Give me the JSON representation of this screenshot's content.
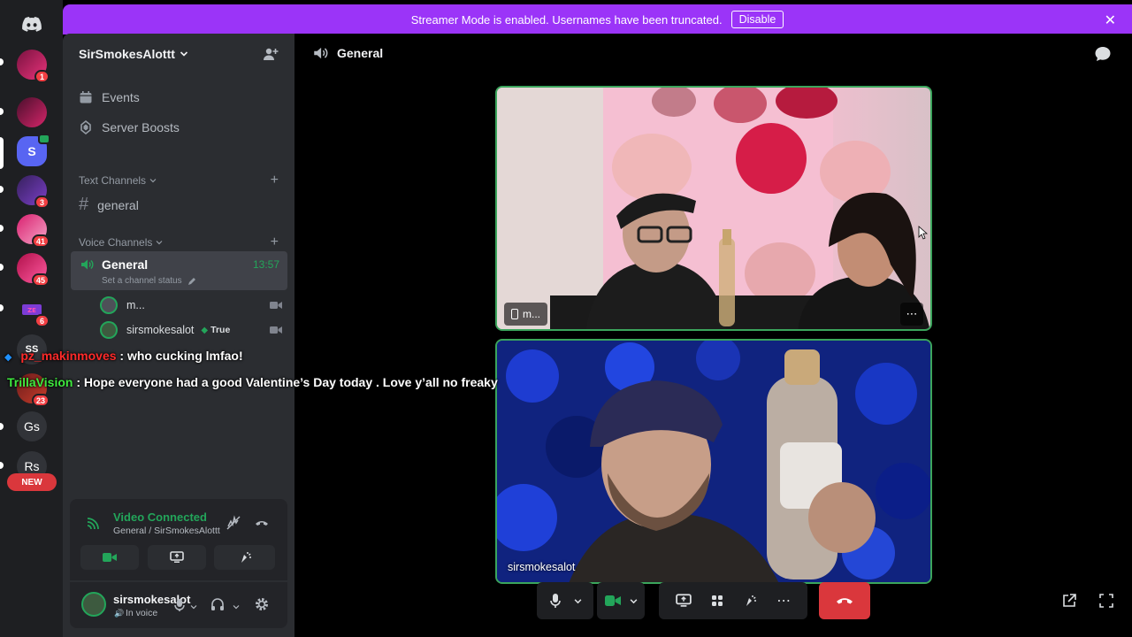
{
  "banner": {
    "message": "Streamer Mode is enabled. Usernames have been truncated.",
    "disable_label": "Disable"
  },
  "rail": {
    "badges": [
      "1",
      "3",
      "41",
      "45",
      "6",
      "23"
    ],
    "text_servers": [
      "SS",
      "Gs",
      "Rs"
    ],
    "selected_letter": "S",
    "new_label": "NEW"
  },
  "server": {
    "name": "SirSmokesAlottt",
    "events": "Events",
    "boosts": "Server Boosts",
    "text_channels_label": "Text Channels",
    "text_channel": "general",
    "voice_channels_label": "Voice Channels",
    "voice_channel": "General",
    "voice_time": "13:57",
    "channel_status_placeholder": "Set a channel status",
    "members": [
      {
        "name": "m..."
      },
      {
        "name": "sirsmokesalot",
        "badge": "True"
      }
    ]
  },
  "chat_overlay": [
    {
      "user": "pz_makinmoves",
      "text": ": who cucking lmfao!",
      "color": "#ff2a2a"
    },
    {
      "user": "TrillaVision",
      "text": ": Hope everyone had a good Valentine’s Day today . Love y’all no freaky",
      "color": "#3fe93f"
    }
  ],
  "voice_panel": {
    "status": "Video Connected",
    "location": "General / SirSmokesAlottt"
  },
  "user_panel": {
    "username": "sirsmokesalot",
    "status": "In voice"
  },
  "main": {
    "channel_title": "General",
    "tile1_label": "m...",
    "tile2_label": "sirsmokesalot"
  },
  "colors": {
    "accent": "#9b34f8",
    "connected_green": "#3ba55c",
    "hangup_red": "#da373c",
    "sidebar": "#2b2d31",
    "rail": "#1e1f22"
  }
}
